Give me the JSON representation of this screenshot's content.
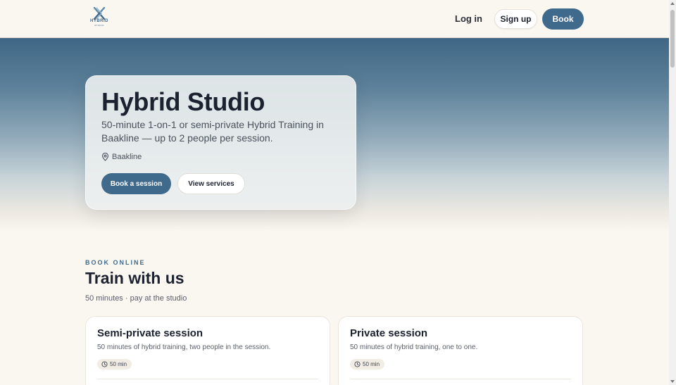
{
  "header": {
    "logo": {
      "word": "HYBRID",
      "sub": "STUDIO",
      "icon": "hybrid-logo-mark"
    },
    "login_label": "Log in",
    "signup_label": "Sign up",
    "book_label": "Book"
  },
  "hero": {
    "title": "Hybrid Studio",
    "description": "50-minute 1-on-1 or semi-private Hybrid Training in Baakline — up to 2 people per session.",
    "location": "Baakline",
    "location_icon": "map-pin-icon",
    "primary_button": "Book a session",
    "secondary_button": "View services"
  },
  "book_online": {
    "eyebrow": "BOOK ONLINE",
    "title": "Train with us",
    "subtitle": "50 minutes · pay at the studio",
    "services": [
      {
        "title": "Semi-private session",
        "description": "50 minutes of hybrid training, two people in the session.",
        "duration": "50 min",
        "duration_icon": "clock-icon"
      },
      {
        "title": "Private session",
        "description": "50 minutes of hybrid training, one to one.",
        "duration": "50 min",
        "duration_icon": "clock-icon"
      }
    ]
  },
  "colors": {
    "accent": "#3f6a8c",
    "background": "#faf6f0",
    "text": "#1d2230"
  }
}
